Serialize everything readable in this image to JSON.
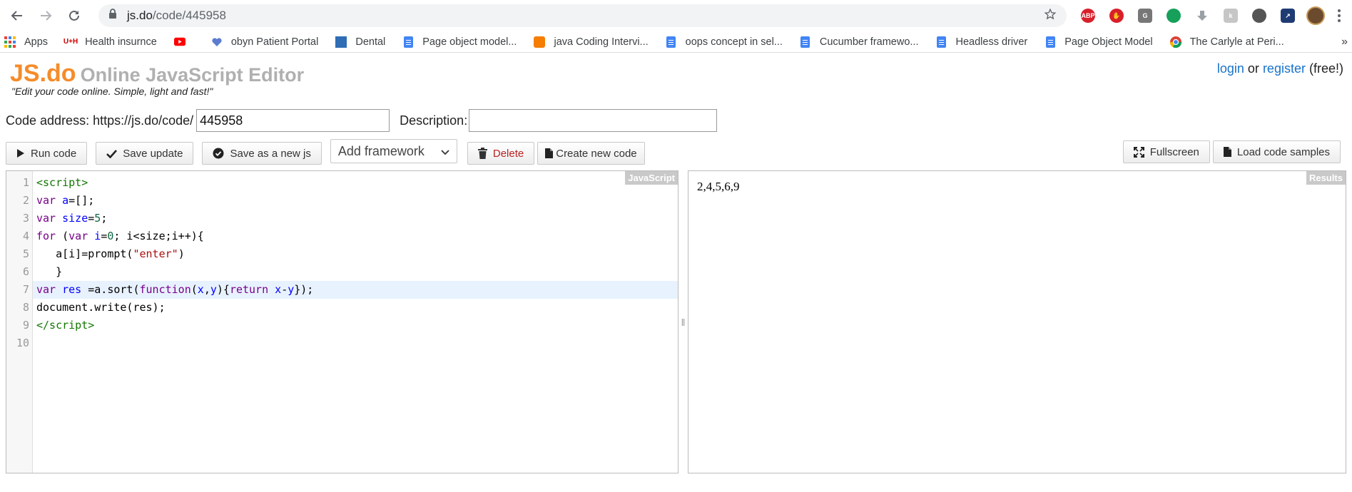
{
  "browser": {
    "url_host": "js.do",
    "url_path": "/code/445958",
    "bookmarks": [
      {
        "label": "Apps",
        "icon": "apps-grid-icon"
      },
      {
        "label": "Health insurnce",
        "icon": "health-icon"
      },
      {
        "label": "",
        "icon": "youtube-icon"
      },
      {
        "label": "obyn Patient Portal",
        "icon": "heart-icon"
      },
      {
        "label": "Dental",
        "icon": "dental-icon"
      },
      {
        "label": "Page object model...",
        "icon": "doc-icon"
      },
      {
        "label": "java Coding Intervi...",
        "icon": "blogger-icon"
      },
      {
        "label": "oops concept in sel...",
        "icon": "doc-icon"
      },
      {
        "label": "Cucumber framewo...",
        "icon": "doc-icon"
      },
      {
        "label": "Headless driver",
        "icon": "doc-icon"
      },
      {
        "label": "Page Object Model",
        "icon": "doc-icon"
      },
      {
        "label": "The Carlyle at Peri...",
        "icon": "chrome-icon"
      }
    ],
    "bookmarks_more": "»",
    "extensions": {
      "abp": "ABP",
      "g": "G"
    }
  },
  "header": {
    "logo": "JS.do",
    "subtitle": "Online JavaScript Editor",
    "tagline": "\"Edit your code online. Simple, light and fast!\"",
    "login": "login",
    "or": "or",
    "register": "register",
    "free": "(free!)"
  },
  "form": {
    "code_address_label": "Code address: https://js.do/code/",
    "code_address_value": "445958",
    "description_label": "Description:",
    "description_value": ""
  },
  "buttons": {
    "run": "Run code",
    "save_update": "Save update",
    "save_new": "Save as a new js",
    "framework": "Add framework",
    "delete": "Delete",
    "create_new": "Create new code",
    "fullscreen": "Fullscreen",
    "load_samples": "Load code samples"
  },
  "editor": {
    "tag": "JavaScript",
    "line_numbers": [
      "1",
      "2",
      "3",
      "4",
      "5",
      "6",
      "7",
      "8",
      "9",
      "10"
    ],
    "active_line": 7
  },
  "results": {
    "tag": "Results",
    "output": "2,4,5,6,9"
  }
}
